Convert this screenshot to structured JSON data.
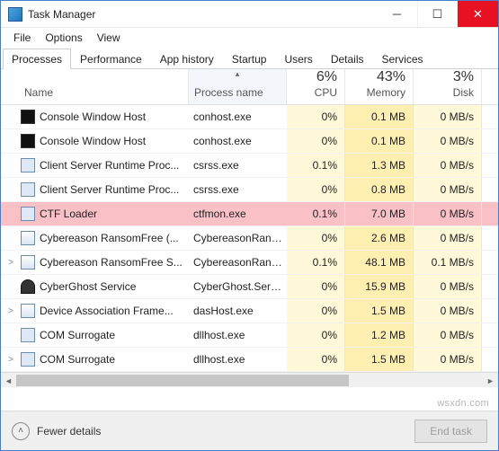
{
  "window": {
    "title": "Task Manager"
  },
  "menu": {
    "file": "File",
    "options": "Options",
    "view": "View"
  },
  "tabs": {
    "processes": "Processes",
    "performance": "Performance",
    "app_history": "App history",
    "startup": "Startup",
    "users": "Users",
    "details": "Details",
    "services": "Services"
  },
  "headers": {
    "name": "Name",
    "process_name": "Process name",
    "cpu_pct": "6%",
    "cpu_label": "CPU",
    "mem_pct": "43%",
    "mem_label": "Memory",
    "disk_pct": "3%",
    "disk_label": "Disk"
  },
  "rows": [
    {
      "expand": "",
      "icon": "term",
      "name": "Console Window Host",
      "proc": "conhost.exe",
      "cpu": "0%",
      "mem": "0.1 MB",
      "disk": "0 MB/s",
      "highlight": false
    },
    {
      "expand": "",
      "icon": "term",
      "name": "Console Window Host",
      "proc": "conhost.exe",
      "cpu": "0%",
      "mem": "0.1 MB",
      "disk": "0 MB/s",
      "highlight": false
    },
    {
      "expand": "",
      "icon": "app",
      "name": "Client Server Runtime Proc...",
      "proc": "csrss.exe",
      "cpu": "0.1%",
      "mem": "1.3 MB",
      "disk": "0 MB/s",
      "highlight": false
    },
    {
      "expand": "",
      "icon": "app",
      "name": "Client Server Runtime Proc...",
      "proc": "csrss.exe",
      "cpu": "0%",
      "mem": "0.8 MB",
      "disk": "0 MB/s",
      "highlight": false
    },
    {
      "expand": "",
      "icon": "app",
      "name": "CTF Loader",
      "proc": "ctfmon.exe",
      "cpu": "0.1%",
      "mem": "7.0 MB",
      "disk": "0 MB/s",
      "highlight": true
    },
    {
      "expand": "",
      "icon": "generic",
      "name": "Cybereason RansomFree (...",
      "proc": "CybereasonRanso...",
      "cpu": "0%",
      "mem": "2.6 MB",
      "disk": "0 MB/s",
      "highlight": false
    },
    {
      "expand": ">",
      "icon": "generic",
      "name": "Cybereason RansomFree S...",
      "proc": "CybereasonRanso...",
      "cpu": "0.1%",
      "mem": "48.1 MB",
      "disk": "0.1 MB/s",
      "highlight": false
    },
    {
      "expand": "",
      "icon": "ghost",
      "name": "CyberGhost Service",
      "proc": "CyberGhost.Servi...",
      "cpu": "0%",
      "mem": "15.9 MB",
      "disk": "0 MB/s",
      "highlight": false
    },
    {
      "expand": ">",
      "icon": "generic",
      "name": "Device Association Frame...",
      "proc": "dasHost.exe",
      "cpu": "0%",
      "mem": "1.5 MB",
      "disk": "0 MB/s",
      "highlight": false
    },
    {
      "expand": "",
      "icon": "app",
      "name": "COM Surrogate",
      "proc": "dllhost.exe",
      "cpu": "0%",
      "mem": "1.2 MB",
      "disk": "0 MB/s",
      "highlight": false
    },
    {
      "expand": ">",
      "icon": "app",
      "name": "COM Surrogate",
      "proc": "dllhost.exe",
      "cpu": "0%",
      "mem": "1.5 MB",
      "disk": "0 MB/s",
      "highlight": false
    }
  ],
  "footer": {
    "fewer": "Fewer details",
    "end_task": "End task"
  },
  "watermark": "wsxdn.com"
}
